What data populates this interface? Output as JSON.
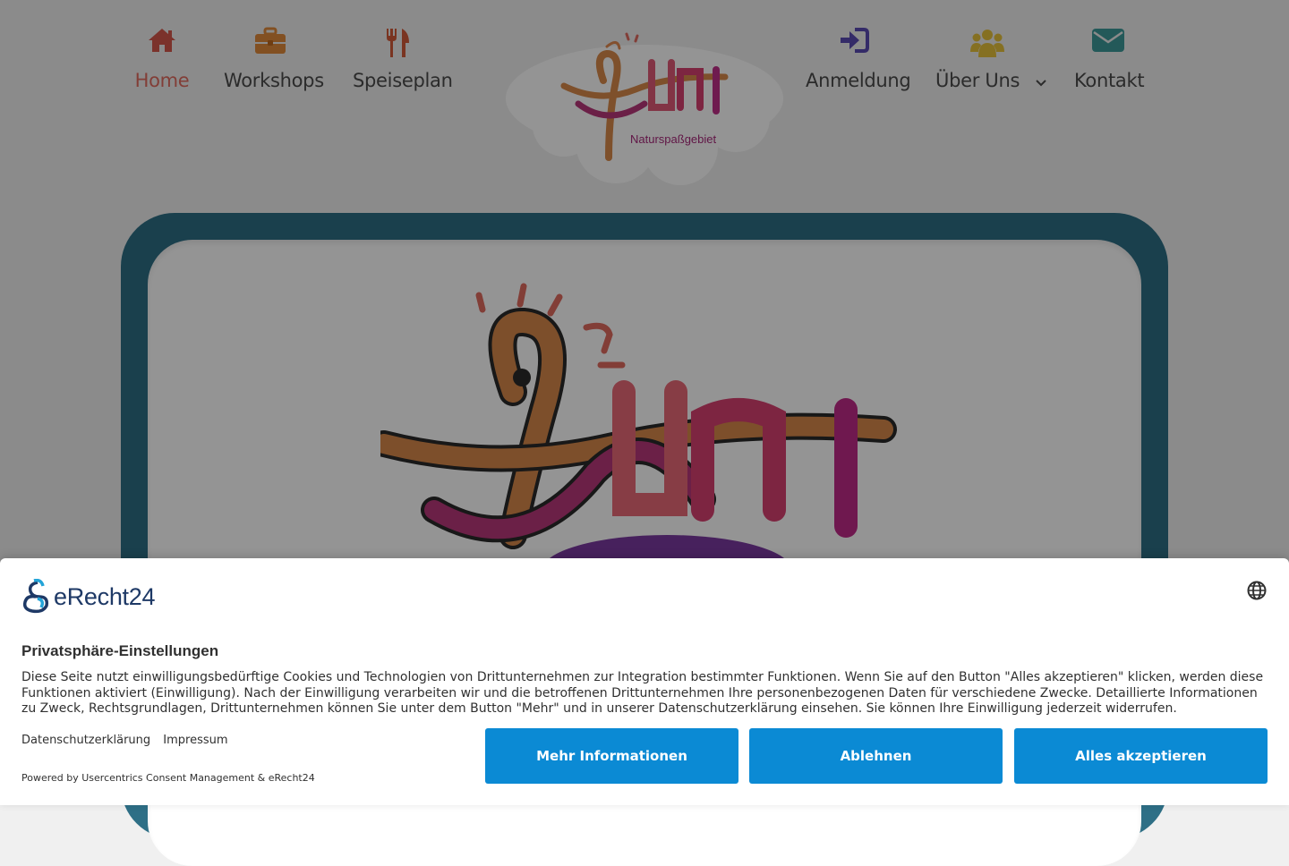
{
  "nav": {
    "items": [
      {
        "label": "Home",
        "icon": "home-icon",
        "color": "#d5574a",
        "active": true
      },
      {
        "label": "Workshops",
        "icon": "briefcase-icon",
        "color": "#e08a3c"
      },
      {
        "label": "Speiseplan",
        "icon": "utensils-icon",
        "color": "#d35b3a"
      },
      {
        "label": "Anmeldung",
        "icon": "sign-in-icon",
        "color": "#5b4bb3"
      },
      {
        "label": "Über Uns",
        "icon": "users-icon",
        "color": "#e6c13c",
        "has_dropdown": true
      },
      {
        "label": "Kontakt",
        "icon": "envelope-icon",
        "color": "#3d9a9a"
      }
    ],
    "logo_tagline": "Naturspaßgebiet"
  },
  "colors": {
    "frame": "#2e6f86",
    "button": "#0b8ad4",
    "active_nav": "#e06b60"
  },
  "consent": {
    "brand": "eRecht24",
    "title": "Privatsphäre-Einstellungen",
    "description": "Diese Seite nutzt einwilligungsbedürftige Cookies und Technologien von Drittunternehmen zur Integration bestimmter Funktionen. Wenn Sie auf den Button \"Alles akzeptieren\" klicken, werden diese Funktionen aktiviert (Einwilligung). Nach der Einwilligung verarbeiten wir und die betroffenen Drittunternehmen Ihre personenbezogenen Daten für verschiedene Zwecke. Detaillierte Informationen zu Zweck, Rechtsgrundlagen, Drittunternehmen können Sie unter dem Button \"Mehr\" und in unserer Datenschutzerklärung einsehen. Sie können Ihre Einwilligung jederzeit widerrufen.",
    "link_privacy": "Datenschutzerklärung",
    "link_imprint": "Impressum",
    "powered_by": "Powered by Usercentrics Consent Management & eRecht24",
    "btn_more": "Mehr Informationen",
    "btn_decline": "Ablehnen",
    "btn_accept": "Alles akzeptieren",
    "language_icon": "globe-icon"
  }
}
